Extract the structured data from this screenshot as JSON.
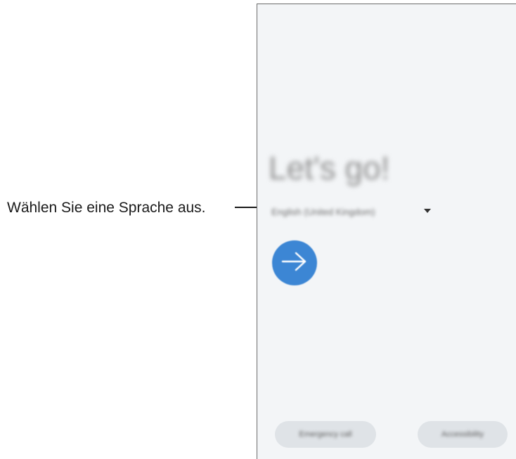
{
  "callout": {
    "text": "Wählen Sie eine Sprache aus."
  },
  "screen": {
    "title": "Let's go!",
    "language_select": {
      "value": "English (United Kingdom)",
      "icon": "chevron-down-icon"
    },
    "next_button": {
      "icon": "arrow-right-icon",
      "color": "#3c86d4"
    },
    "bottom_buttons": {
      "emergency_label": "Emergency call",
      "accessibility_label": "Accessibility"
    }
  }
}
